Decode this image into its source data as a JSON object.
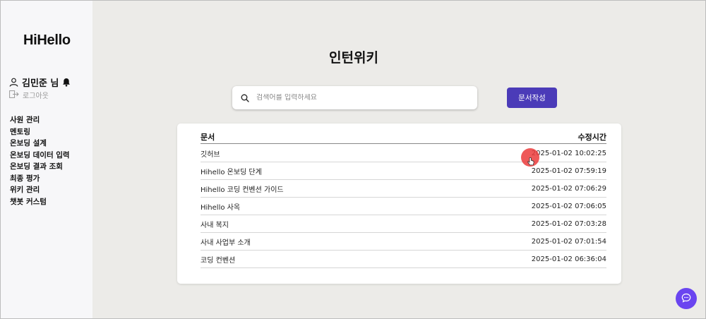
{
  "sidebar": {
    "logo": "HiHello",
    "user_name": "김민준 님",
    "logout_label": "로그아웃",
    "nav": [
      {
        "label": "사원 관리"
      },
      {
        "label": "멘토링"
      },
      {
        "label": "온보딩 설계"
      },
      {
        "label": "온보딩 데이터 입력"
      },
      {
        "label": "온보딩 결과 조회"
      },
      {
        "label": "최종 평가"
      },
      {
        "label": "위키 관리"
      },
      {
        "label": "챗봇 커스텀"
      }
    ]
  },
  "main": {
    "title": "인턴위키",
    "search": {
      "placeholder": "검색어를 입력하세요",
      "value": ""
    },
    "write_button": "문서작성",
    "table": {
      "columns": [
        "문서",
        "수정시간"
      ],
      "rows": [
        {
          "title": "깃허브",
          "modified": "2025-01-02 10:02:25"
        },
        {
          "title": "Hihello 온보딩 단계",
          "modified": "2025-01-02 07:59:19"
        },
        {
          "title": "Hihello 코딩 컨벤션 가이드",
          "modified": "2025-01-02 07:06:29"
        },
        {
          "title": "Hihello 사옥",
          "modified": "2025-01-02 07:06:05"
        },
        {
          "title": "사내 복지",
          "modified": "2025-01-02 07:03:28"
        },
        {
          "title": "사내 사업부 소개",
          "modified": "2025-01-02 07:01:54"
        },
        {
          "title": "코딩 컨벤션",
          "modified": "2025-01-02 06:36:04"
        }
      ]
    }
  },
  "icons": {
    "user": "user-icon",
    "bell": "bell-icon",
    "logout": "logout-icon",
    "search": "search-icon",
    "chat": "chat-icon"
  },
  "colors": {
    "accent": "#4b3bb8",
    "chat_button": "#6a45f0",
    "background": "#ecebe8",
    "sidebar": "#f7f7f9"
  }
}
